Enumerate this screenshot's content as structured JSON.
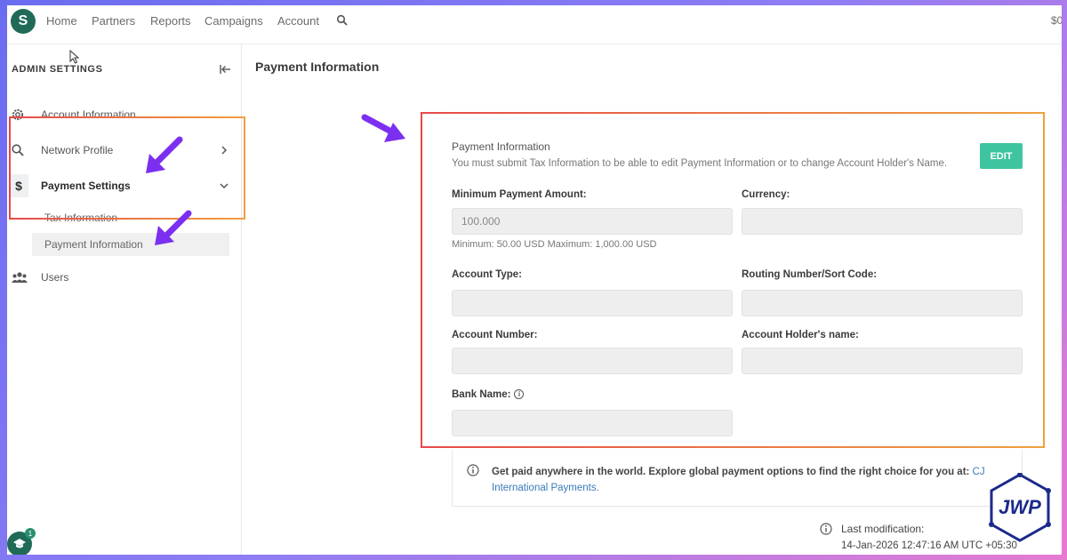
{
  "nav": {
    "items": [
      "Home",
      "Partners",
      "Reports",
      "Campaigns",
      "Account"
    ],
    "right_text": "$0"
  },
  "sidebar": {
    "title": "ADMIN SETTINGS",
    "items": [
      {
        "label": "Account Information",
        "icon": "gear-icon"
      },
      {
        "label": "Network Profile",
        "icon": "search-icon"
      },
      {
        "label": "Payment Settings",
        "icon": "dollar-icon"
      },
      {
        "label": "Users",
        "icon": "users-icon"
      }
    ],
    "sub_items": [
      "Tax Information",
      "Payment Information"
    ],
    "avatar_badge": "1"
  },
  "main": {
    "page_title": "Payment Information",
    "section_title": "Payment Information",
    "section_desc": "You must submit Tax Information to be able to edit Payment Information or to change Account Holder's Name.",
    "edit_label": "EDIT",
    "fields": {
      "min_amount_label": "Minimum Payment Amount:",
      "min_amount_value": "100.000",
      "min_amount_hint": "Minimum: 50.00 USD Maximum: 1,000.00 USD",
      "currency_label": "Currency:",
      "account_type_label": "Account Type:",
      "routing_label": "Routing Number/Sort Code:",
      "account_number_label": "Account Number:",
      "holder_label": "Account Holder's name:",
      "bank_name_label": "Bank Name:"
    },
    "notice_text": "Get paid anywhere in the world. Explore global payment options to find the right choice for you at: ",
    "notice_link": "CJ International Payments.",
    "last_mod_label": "Last modification:",
    "last_mod_value": "14-Jan-2026 12:47:16 AM UTC +05:30"
  },
  "colors": {
    "edit_button": "#3fc4a0",
    "logo": "#1f6b57",
    "annotation_arrow": "#7b2ff0",
    "link": "#3a7ab8"
  },
  "watermark": "JWP"
}
